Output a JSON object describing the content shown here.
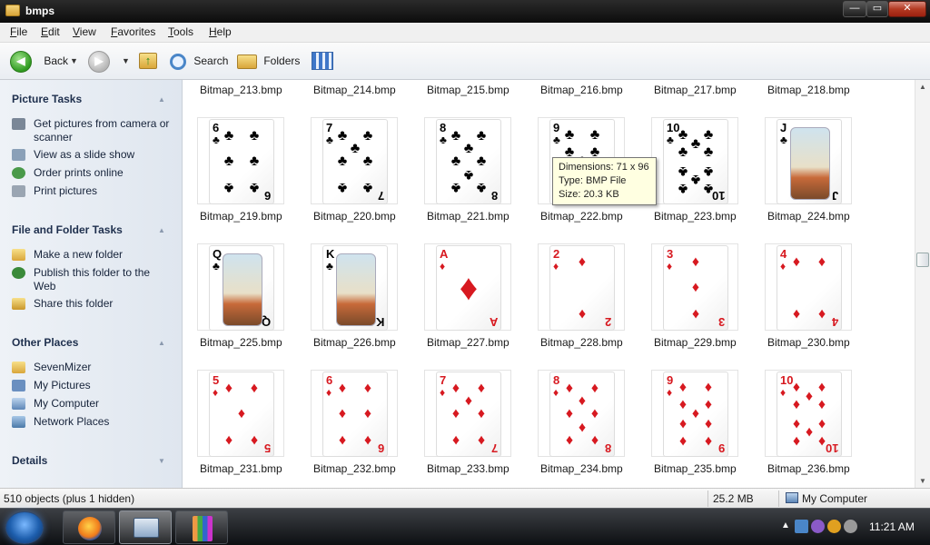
{
  "window": {
    "title": "bmps",
    "min": "—",
    "max": "▭",
    "close": "✕"
  },
  "menu": [
    "File",
    "Edit",
    "View",
    "Favorites",
    "Tools",
    "Help"
  ],
  "toolbar": {
    "back": "Back",
    "search": "Search",
    "folders": "Folders"
  },
  "left_pane": {
    "picture_tasks": {
      "title": "Picture Tasks",
      "items": [
        "Get pictures from camera or scanner",
        "View as a slide show",
        "Order prints online",
        "Print pictures"
      ]
    },
    "file_tasks": {
      "title": "File and Folder Tasks",
      "items": [
        "Make a new folder",
        "Publish this folder to the Web",
        "Share this folder"
      ]
    },
    "other_places": {
      "title": "Other Places",
      "items": [
        "SevenMizer",
        "My Pictures",
        "My Computer",
        "Network Places"
      ]
    },
    "details": {
      "title": "Details"
    }
  },
  "files": {
    "row0": [
      "Bitmap_213.bmp",
      "Bitmap_214.bmp",
      "Bitmap_215.bmp",
      "Bitmap_216.bmp",
      "Bitmap_217.bmp",
      "Bitmap_218.bmp"
    ],
    "row1": [
      "Bitmap_219.bmp",
      "Bitmap_220.bmp",
      "Bitmap_221.bmp",
      "Bitmap_222.bmp",
      "Bitmap_223.bmp",
      "Bitmap_224.bmp"
    ],
    "row2": [
      "Bitmap_225.bmp",
      "Bitmap_226.bmp",
      "Bitmap_227.bmp",
      "Bitmap_228.bmp",
      "Bitmap_229.bmp",
      "Bitmap_230.bmp"
    ],
    "row3": [
      "Bitmap_231.bmp",
      "Bitmap_232.bmp",
      "Bitmap_233.bmp",
      "Bitmap_234.bmp",
      "Bitmap_235.bmp",
      "Bitmap_236.bmp"
    ]
  },
  "cards": {
    "row1": [
      {
        "rank": "6",
        "suit": "♣",
        "color": "#000000"
      },
      {
        "rank": "7",
        "suit": "♣",
        "color": "#000000"
      },
      {
        "rank": "8",
        "suit": "♣",
        "color": "#000000"
      },
      {
        "rank": "9",
        "suit": "♣",
        "color": "#000000"
      },
      {
        "rank": "10",
        "suit": "♣",
        "color": "#000000"
      },
      {
        "rank": "J",
        "suit": "♣",
        "color": "#000000"
      }
    ],
    "row2": [
      {
        "rank": "Q",
        "suit": "♣",
        "color": "#000000"
      },
      {
        "rank": "K",
        "suit": "♣",
        "color": "#000000"
      },
      {
        "rank": "A",
        "suit": "♦",
        "color": "#d71920"
      },
      {
        "rank": "2",
        "suit": "♦",
        "color": "#d71920"
      },
      {
        "rank": "3",
        "suit": "♦",
        "color": "#d71920"
      },
      {
        "rank": "4",
        "suit": "♦",
        "color": "#d71920"
      }
    ],
    "row3": [
      {
        "rank": "5",
        "suit": "♦",
        "color": "#d71920"
      },
      {
        "rank": "6",
        "suit": "♦",
        "color": "#d71920"
      },
      {
        "rank": "7",
        "suit": "♦",
        "color": "#d71920"
      },
      {
        "rank": "8",
        "suit": "♦",
        "color": "#d71920"
      },
      {
        "rank": "9",
        "suit": "♦",
        "color": "#d71920"
      },
      {
        "rank": "10",
        "suit": "♦",
        "color": "#d71920"
      }
    ]
  },
  "tooltip": {
    "dimensions": "Dimensions: 71 x 96",
    "type": "Type: BMP File",
    "size": "Size: 20.3 KB"
  },
  "status": {
    "count": "510 objects (plus 1 hidden)",
    "size": "25.2 MB",
    "location": "My Computer"
  },
  "taskbar": {
    "clock": "11:21 AM"
  }
}
